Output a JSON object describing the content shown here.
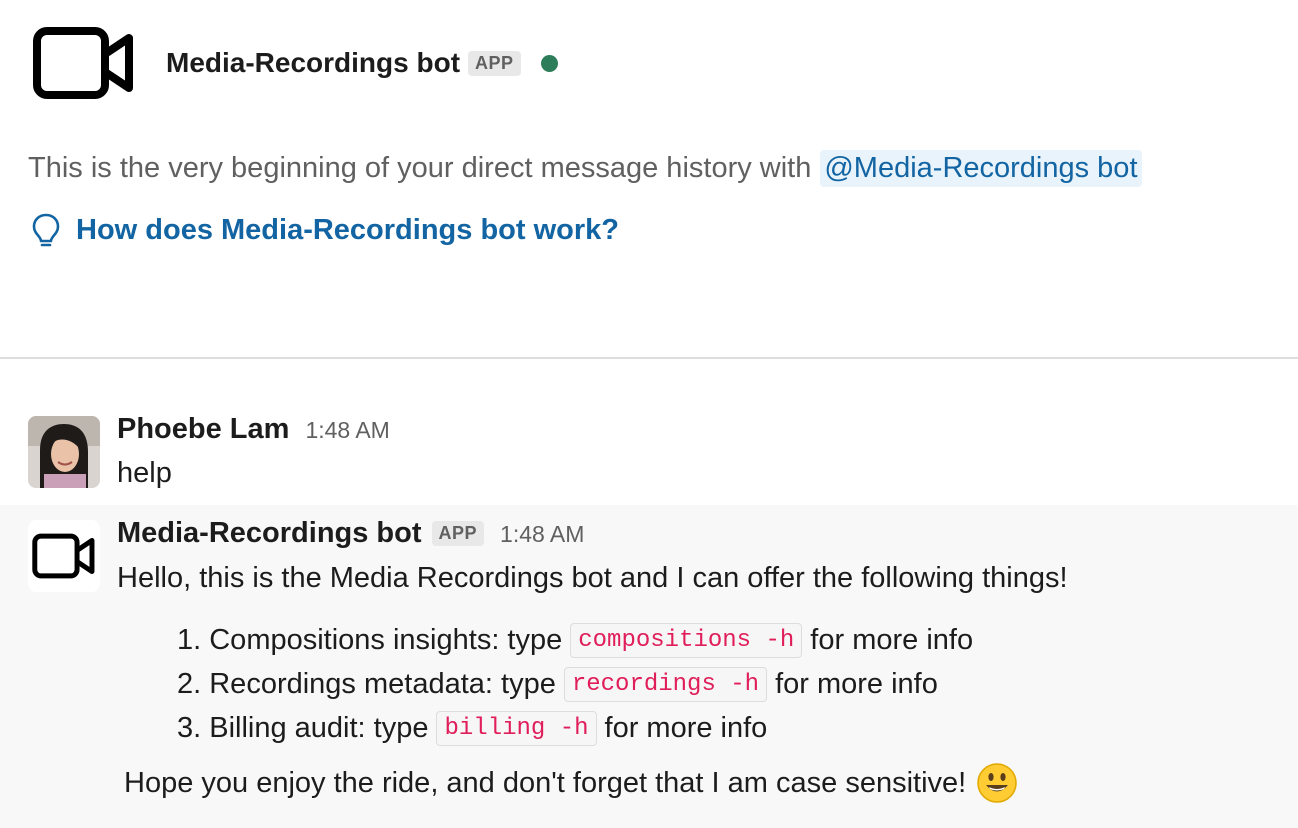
{
  "header": {
    "bot_name": "Media-Recordings bot",
    "app_badge": "APP",
    "presence_color": "#2e7d5a"
  },
  "intro": {
    "text": "This is the very beginning of your direct message history with",
    "mention": "@Media-Recordings bot",
    "help_link": "How does Media-Recordings bot work?"
  },
  "messages": [
    {
      "sender": "Phoebe Lam",
      "time": "1:48 AM",
      "text": "help"
    },
    {
      "sender": "Media-Recordings bot",
      "badge": "APP",
      "time": "1:48 AM",
      "intro": "Hello, this is the Media Recordings bot and I can offer the following things!",
      "items": [
        {
          "prefix": "1. Compositions insights: type",
          "code": "compositions -h",
          "suffix": "for more info"
        },
        {
          "prefix": "2. Recordings metadata: type",
          "code": "recordings -h",
          "suffix": "for more info"
        },
        {
          "prefix": "3. Billing audit: type",
          "code": "billing -h",
          "suffix": "for more info"
        }
      ],
      "outro": "Hope you enjoy the ride, and don't forget that I am case sensitive!",
      "emoji": "smiley-emoji"
    }
  ],
  "colors": {
    "link": "#1264a3",
    "code_text": "#e01e5a",
    "message_hover_bg": "#f8f8f8"
  }
}
